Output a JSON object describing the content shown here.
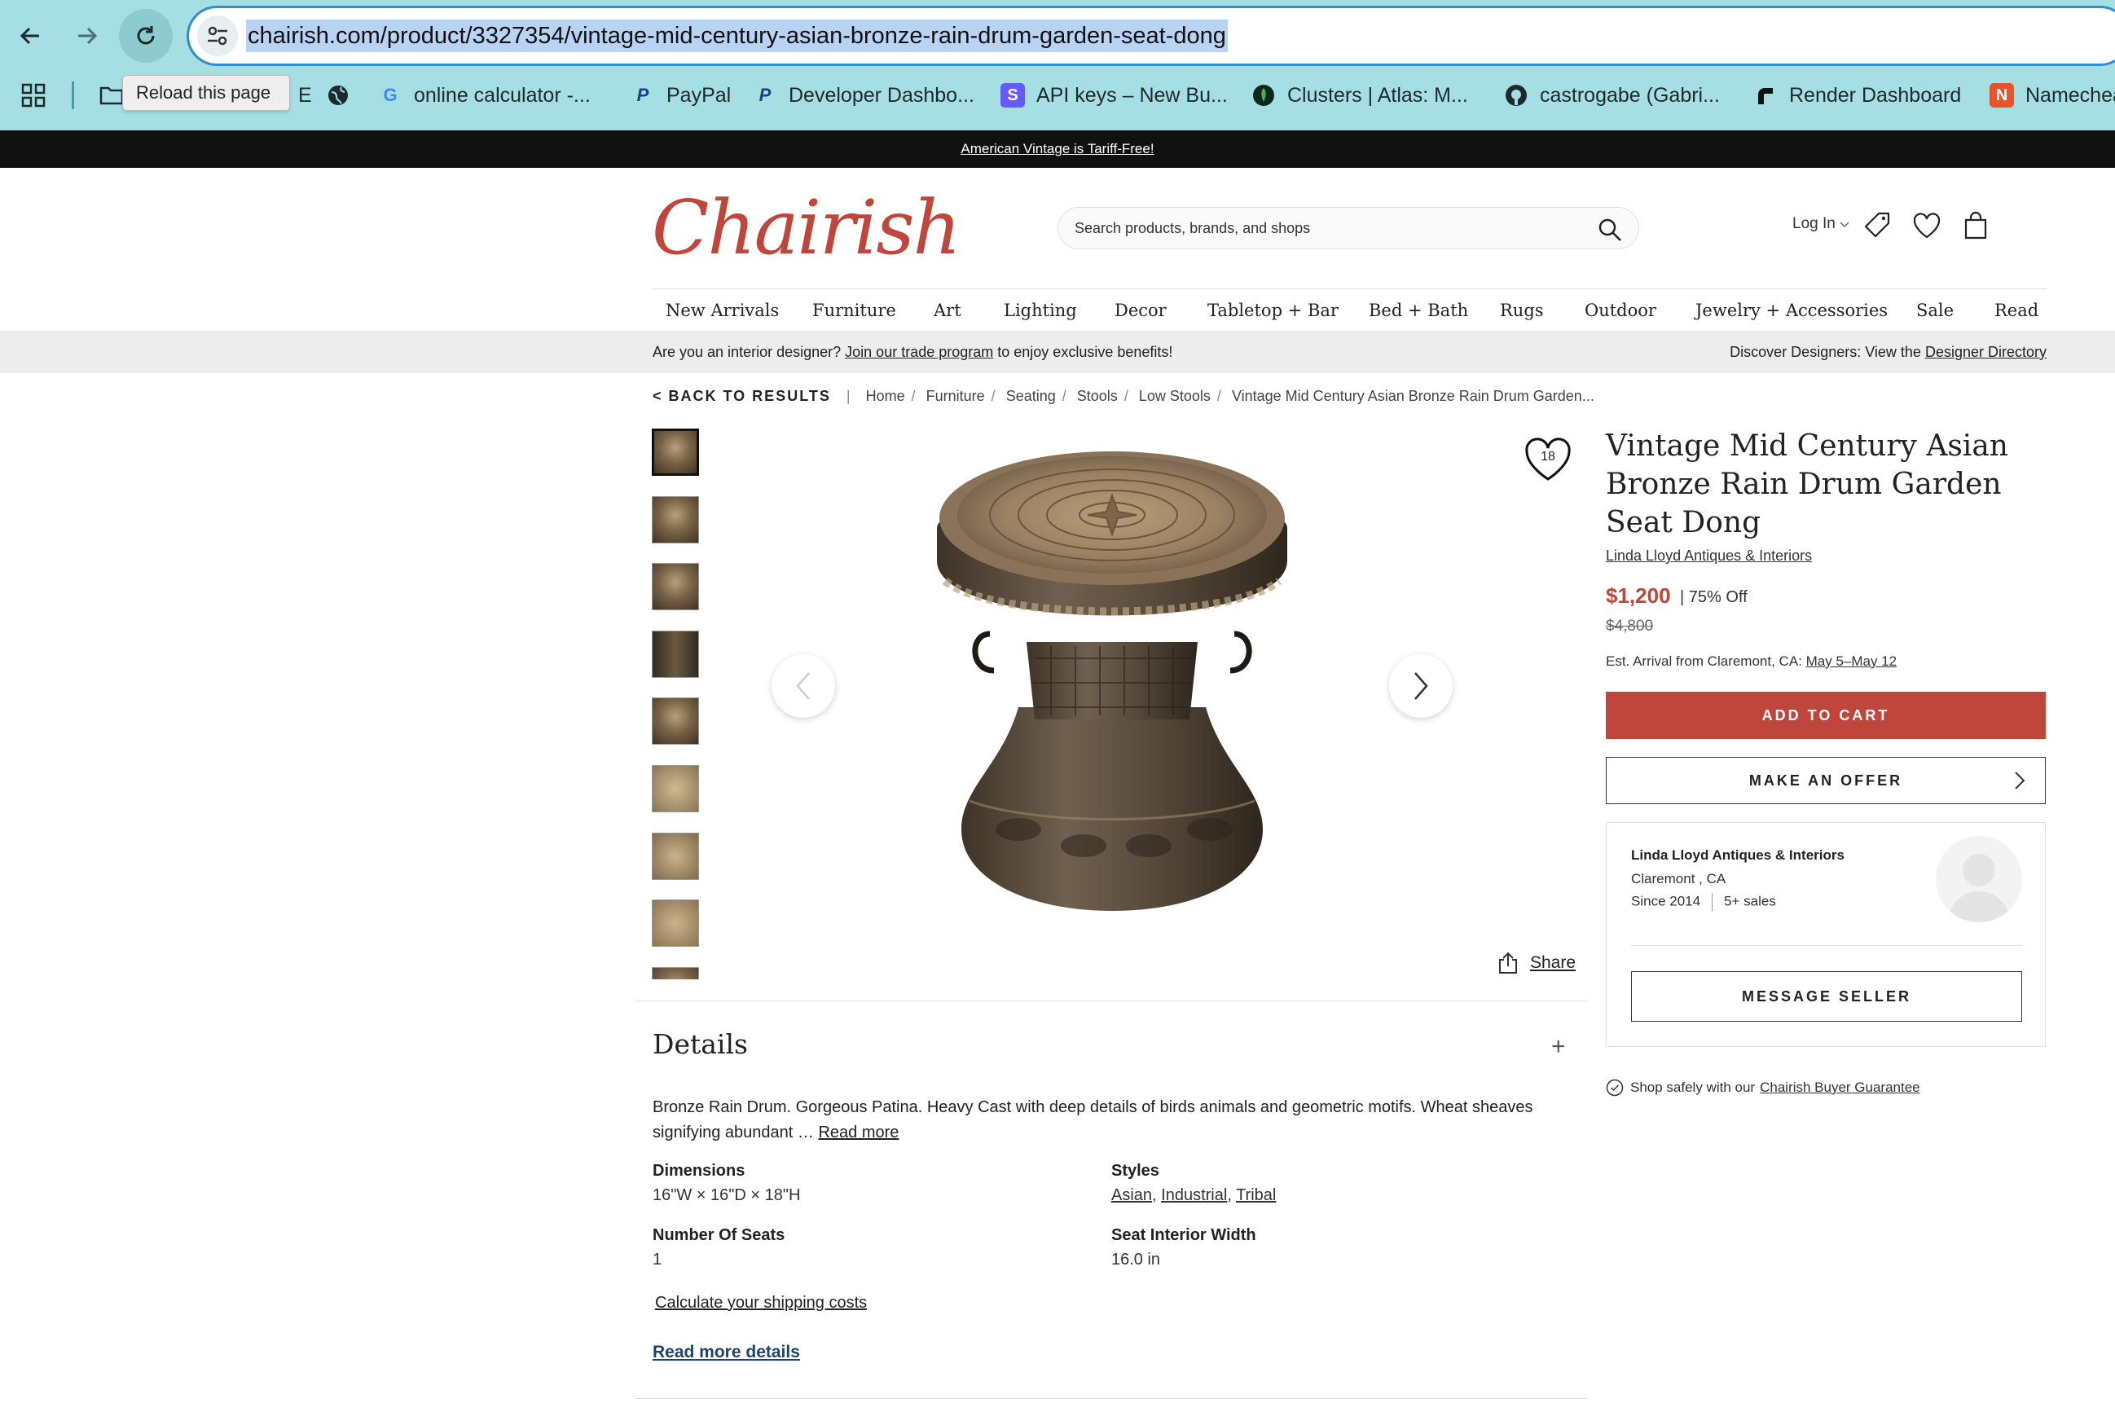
{
  "browser": {
    "url": "chairish.com/product/3327354/vintage-mid-century-asian-bronze-rain-drum-garden-seat-dong",
    "tooltip": "Reload this page",
    "bookmarks": [
      {
        "label": "E",
        "icon": "folder-icon"
      },
      {
        "label": "",
        "icon": "globe-icon"
      },
      {
        "label": "online calculator -...",
        "icon": "google-icon"
      },
      {
        "label": "PayPal",
        "icon": "paypal-icon"
      },
      {
        "label": "Developer Dashbo...",
        "icon": "paypal-icon"
      },
      {
        "label": "API keys – New Bu...",
        "icon": "stripe-icon"
      },
      {
        "label": "Clusters | Atlas: M...",
        "icon": "mongodb-icon"
      },
      {
        "label": "castrogabe (Gabri...",
        "icon": "github-icon"
      },
      {
        "label": "Render Dashboard",
        "icon": "render-icon"
      },
      {
        "label": "Namechea",
        "icon": "namecheap-icon"
      }
    ]
  },
  "promo": "American Vintage is Tariff-Free!",
  "header": {
    "logo": "Chairish",
    "search_placeholder": "Search products, brands, and shops",
    "login": "Log In"
  },
  "nav": [
    "New Arrivals",
    "Furniture",
    "Art",
    "Lighting",
    "Decor",
    "Tabletop + Bar",
    "Bed + Bath",
    "Rugs",
    "Outdoor",
    "Jewelry + Accessories",
    "Sale",
    "Read"
  ],
  "trade": {
    "left_pre": "Are you an interior designer?",
    "left_link": "Join our trade program",
    "left_post": "to enjoy exclusive benefits!",
    "right_pre": "Discover Designers: View the",
    "right_link": "Designer Directory"
  },
  "breadcrumb": {
    "back": "< BACK TO RESULTS",
    "items": [
      "Home",
      "Furniture",
      "Seating",
      "Stools",
      "Low Stools",
      "Vintage Mid Century Asian Bronze Rain Drum Garden..."
    ]
  },
  "product": {
    "title": "Vintage Mid Century Asian Bronze Rain Drum Garden Seat Dong",
    "seller": "Linda Lloyd Antiques & Interiors",
    "price": "$1,200",
    "discount": "75% Off",
    "original_price": "$4,800",
    "arrival_pre": "Est. Arrival from Claremont, CA:",
    "arrival_dates": "May 5–May 12",
    "favorites": "18",
    "add_to_cart": "ADD TO CART",
    "make_offer": "MAKE AN OFFER",
    "share": "Share"
  },
  "seller_card": {
    "name": "Linda Lloyd Antiques & Interiors",
    "location": "Claremont , CA",
    "since": "Since 2014",
    "sales": "5+ sales",
    "message": "MESSAGE SELLER"
  },
  "guarantee": {
    "pre": "Shop safely with our",
    "link": "Chairish Buyer Guarantee"
  },
  "details": {
    "title": "Details",
    "toggle": "+",
    "description": "Bronze Rain Drum. Gorgeous Patina. Heavy Cast with deep details of birds animals and geometric motifs. Wheat sheaves signifying abundant …",
    "read_more": "Read more",
    "dimensions_label": "Dimensions",
    "dimensions": "16\"W × 16\"D × 18\"H",
    "styles_label": "Styles",
    "styles": [
      "Asian",
      "Industrial",
      "Tribal"
    ],
    "seats_label": "Number Of Seats",
    "seats": "1",
    "seat_width_label": "Seat Interior Width",
    "seat_width": "16.0 in",
    "calc_shipping": "Calculate your shipping costs",
    "read_more_details": "Read more details"
  }
}
